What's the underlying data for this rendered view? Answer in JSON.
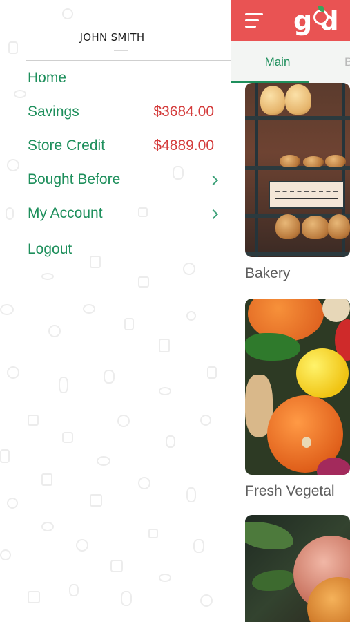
{
  "drawer": {
    "user_name": "JOHN SMITH",
    "menu": [
      {
        "label": "Home"
      },
      {
        "label": "Savings",
        "value": "$3684.00"
      },
      {
        "label": "Store Credit",
        "value": "$4889.00"
      },
      {
        "label": "Bought Before",
        "icon": "chevron-right-icon"
      },
      {
        "label": "My Account",
        "icon": "chevron-right-icon"
      },
      {
        "label": "Logout"
      }
    ]
  },
  "app": {
    "logo_text": "g  d",
    "header_color": "#e95353",
    "tabs": [
      {
        "label": "Main",
        "active": true
      },
      {
        "label": "B"
      }
    ],
    "categories": [
      {
        "label": "Bakery"
      },
      {
        "label": "Fresh Vegetal"
      },
      {
        "label": ""
      }
    ]
  },
  "colors": {
    "accent_green": "#1e8f5c",
    "value_red": "#d43c3c",
    "header_red": "#e95353"
  }
}
